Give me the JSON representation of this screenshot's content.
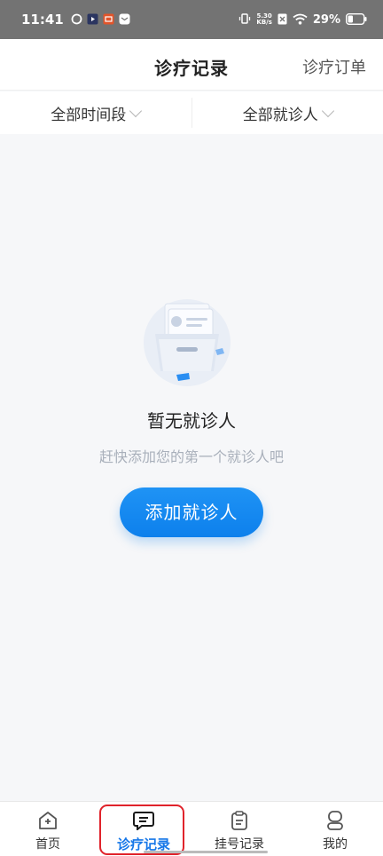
{
  "status_bar": {
    "time": "11:41",
    "net_speed_value": "5.30",
    "net_speed_unit": "KB/s",
    "battery": "29%"
  },
  "header": {
    "title": "诊疗记录",
    "action": "诊疗订单"
  },
  "filters": {
    "time_range": "全部时间段",
    "patient": "全部就诊人"
  },
  "empty_state": {
    "title": "暂无就诊人",
    "subtitle": "赶快添加您的第一个就诊人吧",
    "button": "添加就诊人"
  },
  "tabbar": {
    "items": [
      {
        "label": "首页",
        "icon": "home-plus-icon"
      },
      {
        "label": "诊疗记录",
        "icon": "chat-record-icon",
        "active": true
      },
      {
        "label": "挂号记录",
        "icon": "clipboard-icon"
      },
      {
        "label": "我的",
        "icon": "user-icon"
      }
    ]
  },
  "colors": {
    "accent": "#0d80ec",
    "active_tab": "#1677e8",
    "highlight": "#e0232b",
    "status_bar": "#737373"
  }
}
